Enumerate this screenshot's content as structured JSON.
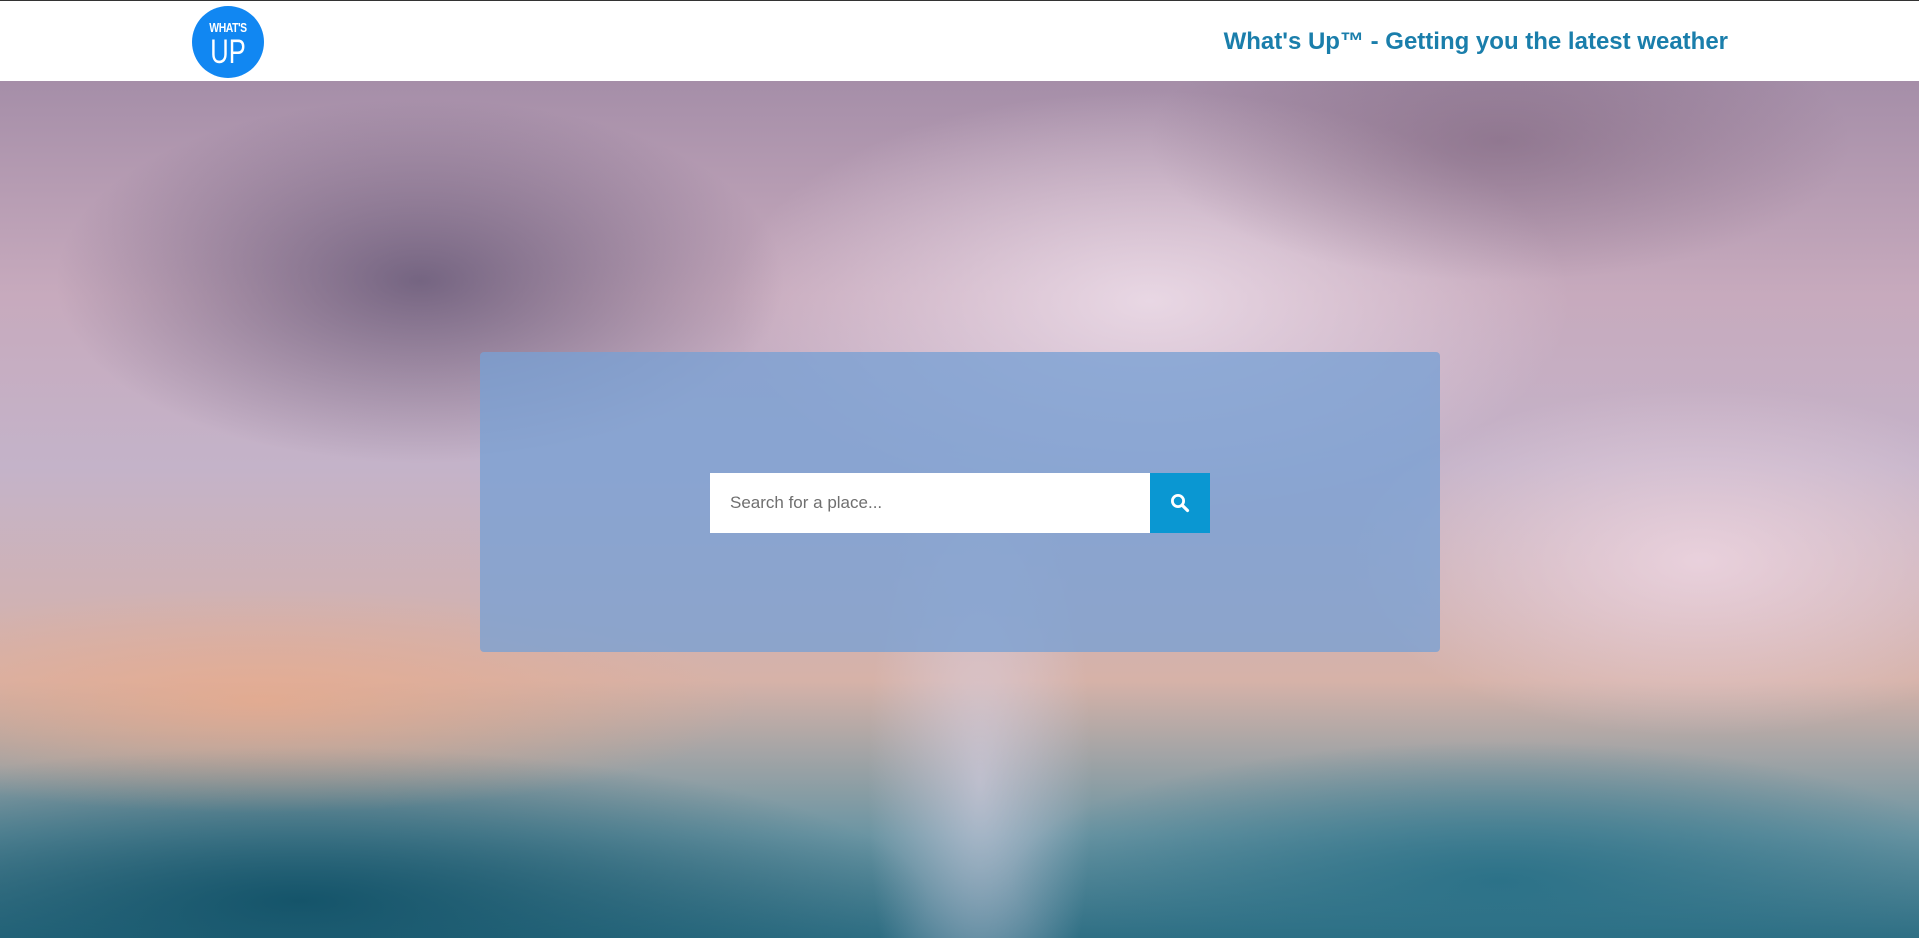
{
  "header": {
    "logo": {
      "line1": "WHAT'S",
      "line2": "UP"
    },
    "tagline": "What's Up™ - Getting you the latest weather"
  },
  "search": {
    "placeholder": "Search for a place...",
    "value": "",
    "button_icon": "search-icon"
  },
  "colors": {
    "logo_bg": "#1187f2",
    "tagline": "#1a7eab",
    "search_button": "#0a97d2",
    "panel": "rgba(120,160,212,0.78)"
  }
}
